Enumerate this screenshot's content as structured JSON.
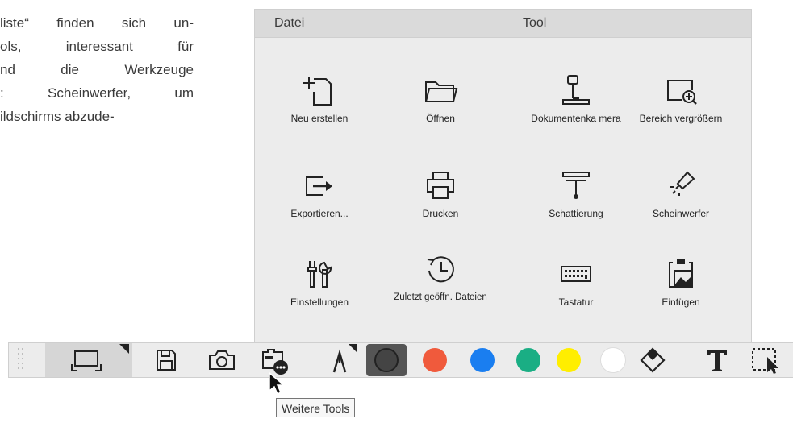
{
  "doc_text": [
    "liste“ finden sich un-",
    "ols,  interessant  für",
    "nd  die  Werkzeuge",
    ":  Scheinwerfer,  um",
    "ildschirms   abzude-"
  ],
  "menu": {
    "datei": {
      "header": "Datei",
      "items": [
        {
          "label": "Neu erstellen",
          "icon": "new-file-icon"
        },
        {
          "label": "Öffnen",
          "icon": "folder-icon"
        },
        {
          "label": "Exportieren...",
          "icon": "export-icon"
        },
        {
          "label": "Drucken",
          "icon": "printer-icon"
        },
        {
          "label": "Einstellungen",
          "icon": "tools-icon"
        },
        {
          "label": "Zuletzt geöffn. Dateien",
          "icon": "recent-clock-icon"
        }
      ]
    },
    "tool": {
      "header": "Tool",
      "items": [
        {
          "label": "Dokumentenka mera",
          "icon": "document-camera-icon"
        },
        {
          "label": "Bereich vergrößern",
          "icon": "zoom-area-icon"
        },
        {
          "label": "Schattierung",
          "icon": "shade-icon"
        },
        {
          "label": "Scheinwerfer",
          "icon": "spotlight-icon"
        },
        {
          "label": "Tastatur",
          "icon": "keyboard-icon"
        },
        {
          "label": "Einfügen",
          "icon": "insert-image-icon"
        }
      ]
    }
  },
  "toolbar": {
    "icons": [
      "grip-icon",
      "board-mode-icon",
      "save-icon",
      "camera-icon",
      "more-tools-icon",
      "pen-icon",
      "eraser-icon",
      "text-icon",
      "selection-icon"
    ],
    "colors": [
      "#444444",
      "#f05a3c",
      "#1a7ef0",
      "#1aae84",
      "#ffee00",
      "#ffffff"
    ]
  },
  "tooltip": "Weitere Tools"
}
